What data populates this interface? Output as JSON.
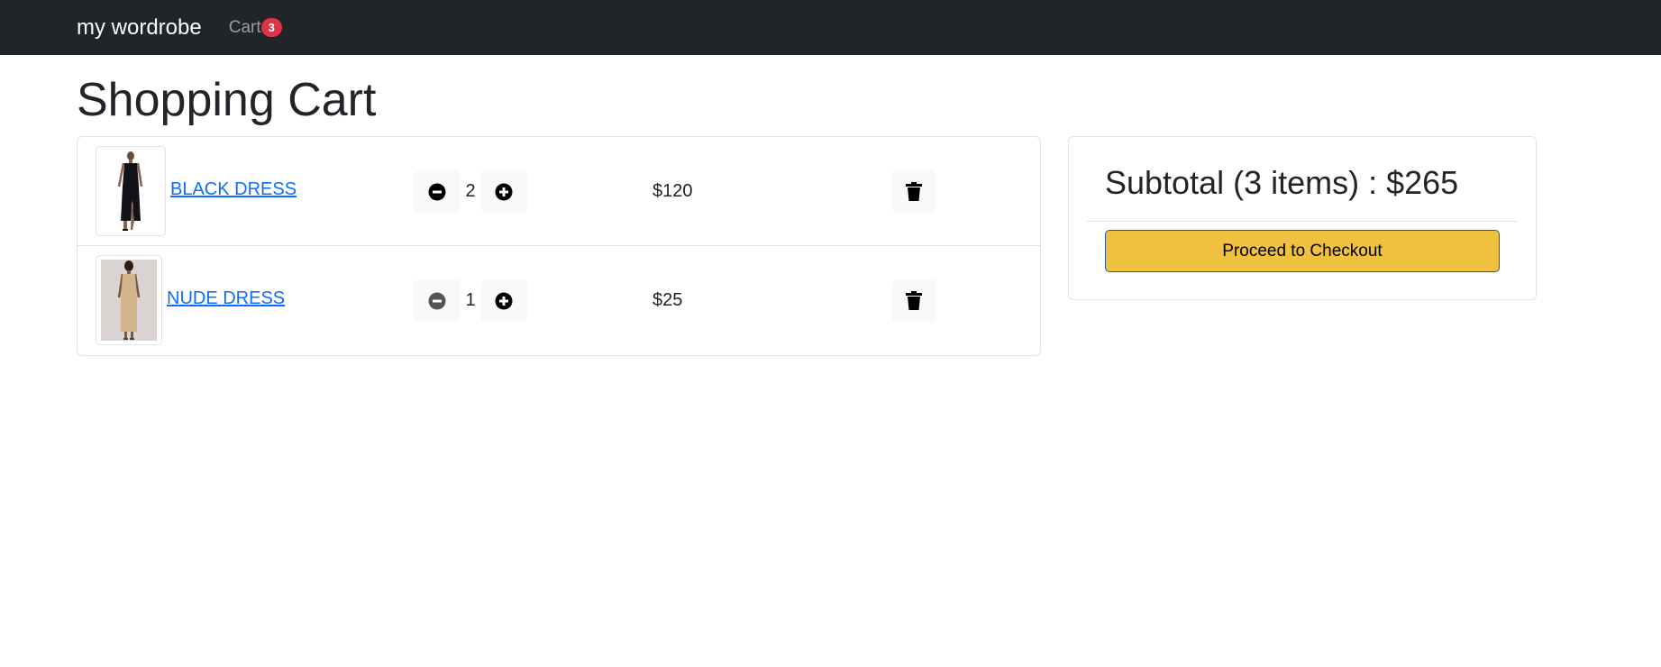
{
  "navbar": {
    "brand": "my wordrobe",
    "cart_label": "Cart",
    "cart_count": "3"
  },
  "page": {
    "title": "Shopping Cart"
  },
  "cart": {
    "items": [
      {
        "name": "BLACK DRESS",
        "quantity": "2",
        "price": "$120",
        "image": "black-dress-thumbnail"
      },
      {
        "name": "NUDE DRESS",
        "quantity": "1",
        "price": "$25",
        "image": "nude-dress-thumbnail"
      }
    ],
    "icons": {
      "decrease": "minus-circle-icon",
      "increase": "plus-circle-icon",
      "remove": "trash-icon"
    }
  },
  "summary": {
    "title": "Subtotal (3 items) : $265",
    "checkout_label": "Proceed to Checkout"
  },
  "colors": {
    "navbar": "#212529",
    "badge": "#dc3545",
    "link": "#0d6efd",
    "checkout": "#f0c03f"
  }
}
